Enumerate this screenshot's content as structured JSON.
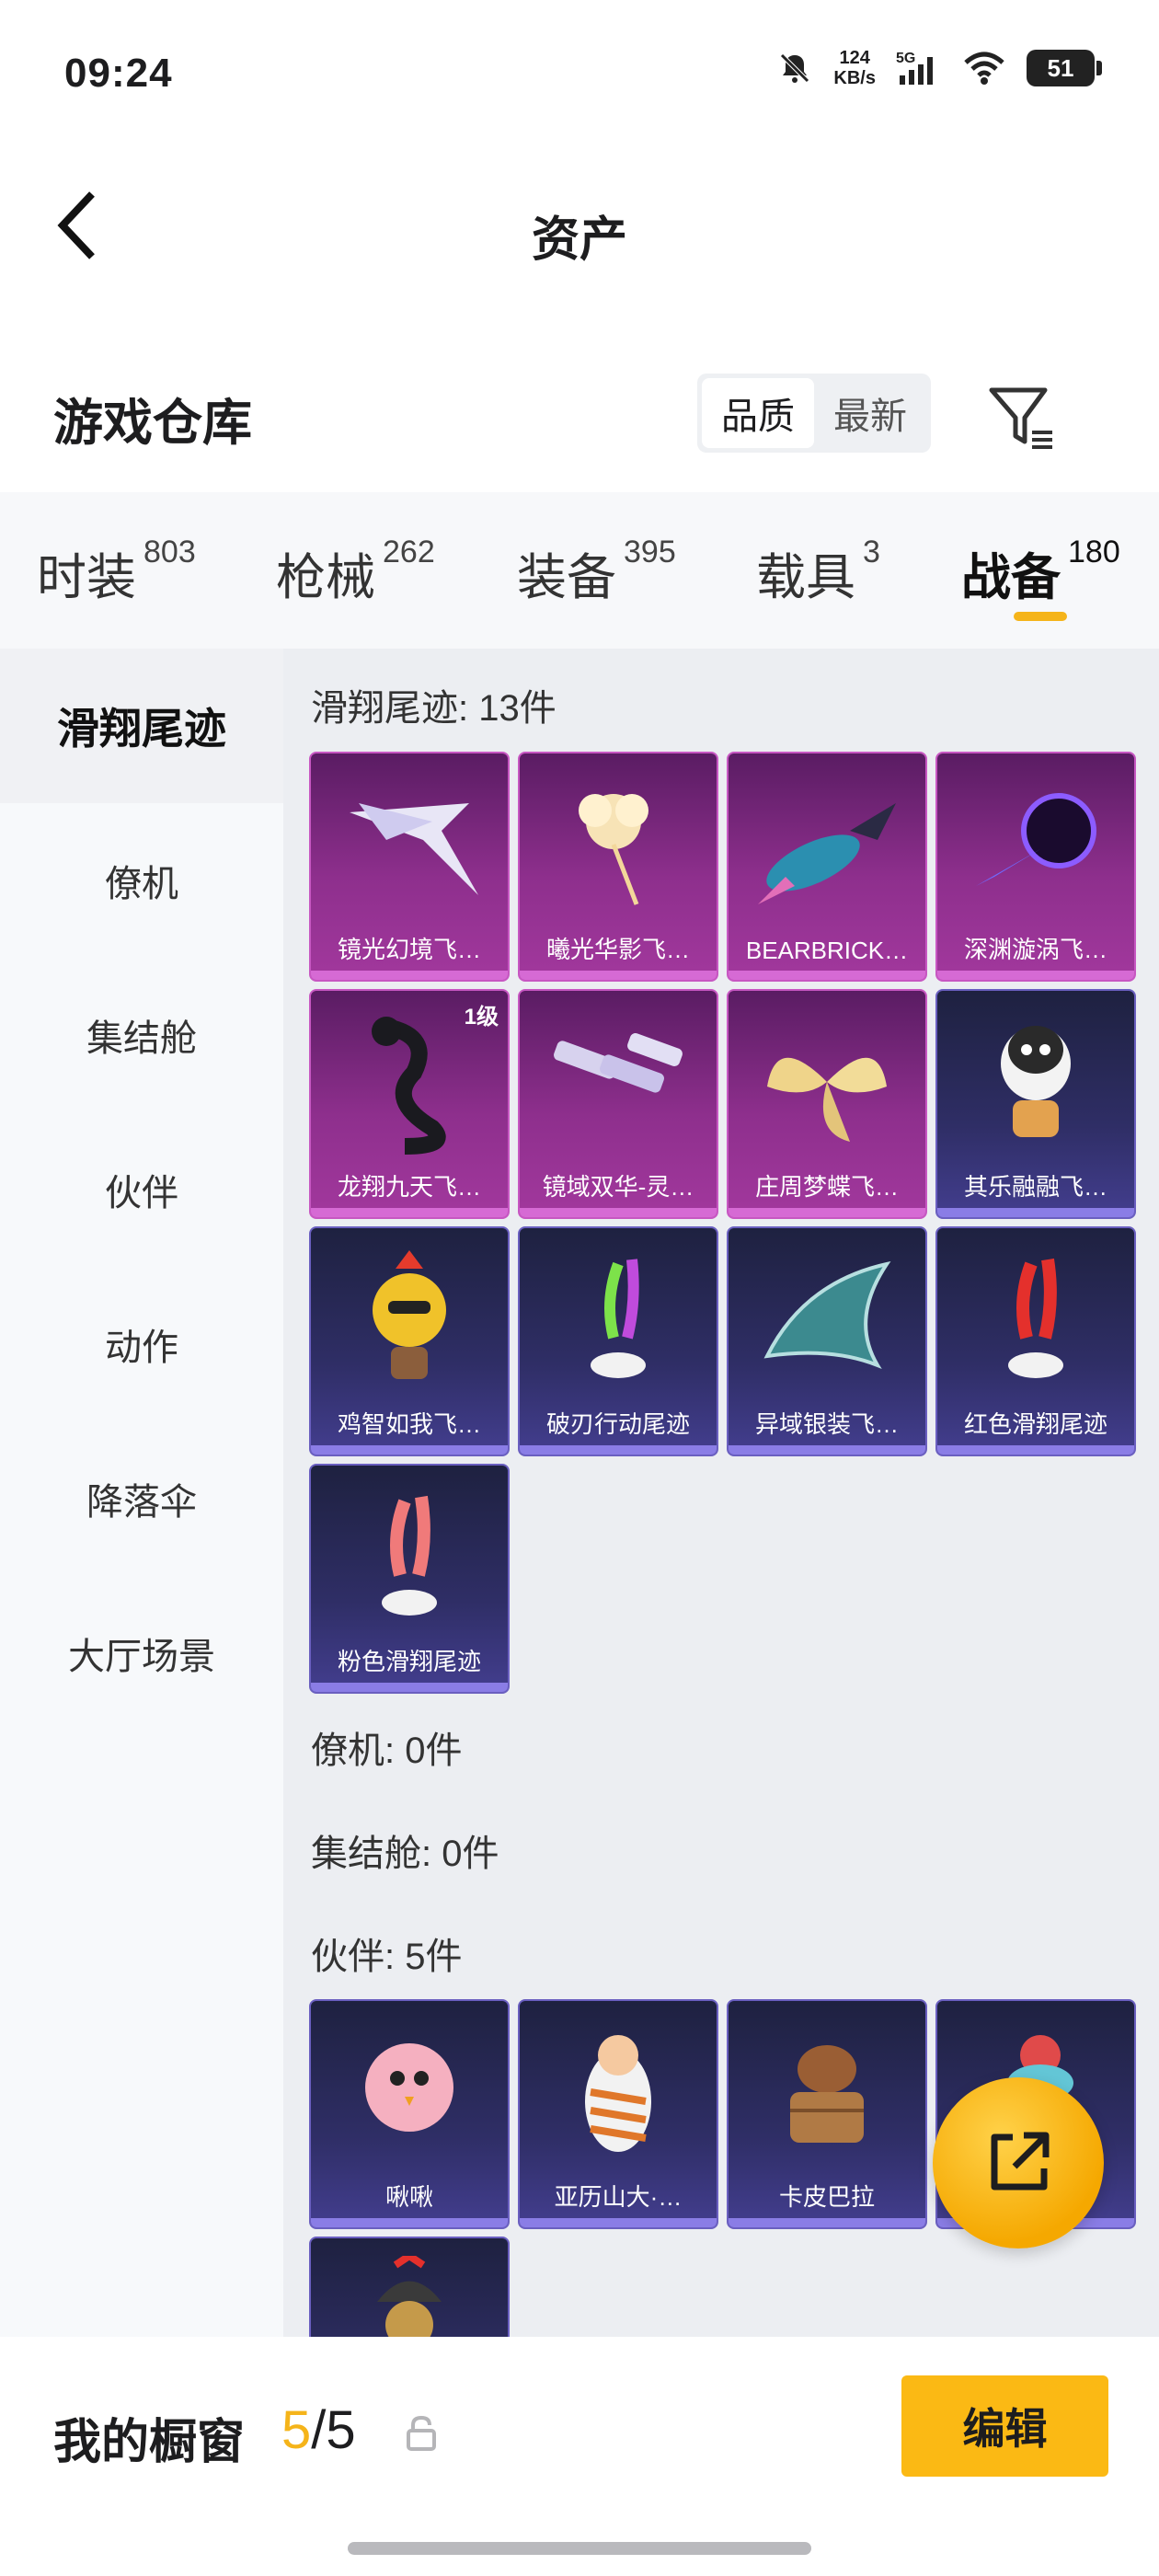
{
  "status_bar": {
    "time": "09:24",
    "net_speed_value": "124",
    "net_speed_unit": "KB/s",
    "network": "5G",
    "battery": "51"
  },
  "header": {
    "title": "资产"
  },
  "warehouse": {
    "title": "游戏仓库",
    "sort_options": [
      "品质",
      "最新"
    ],
    "sort_active": "品质"
  },
  "category_tabs": [
    {
      "label": "时装",
      "count": "803"
    },
    {
      "label": "枪械",
      "count": "262"
    },
    {
      "label": "装备",
      "count": "395"
    },
    {
      "label": "载具",
      "count": "3"
    },
    {
      "label": "战备",
      "count": "180",
      "active": true
    }
  ],
  "sidebar": {
    "items": [
      "滑翔尾迹",
      "僚机",
      "集结舱",
      "伙伴",
      "动作",
      "降落伞",
      "大厅场景"
    ],
    "active": "滑翔尾迹"
  },
  "sections": [
    {
      "label": "滑翔尾迹: 13件",
      "items": [
        {
          "name": "镜光幻境飞…",
          "rarity": "purple"
        },
        {
          "name": "曦光华影飞…",
          "rarity": "purple"
        },
        {
          "name": "BEARBRICK…",
          "rarity": "purple"
        },
        {
          "name": "深渊漩涡飞…",
          "rarity": "purple"
        },
        {
          "name": "龙翔九天飞…",
          "rarity": "purple",
          "level": "1级"
        },
        {
          "name": "镜域双华-灵…",
          "rarity": "purple"
        },
        {
          "name": "庄周梦蝶飞…",
          "rarity": "purple"
        },
        {
          "name": "其乐融融飞…",
          "rarity": "blue"
        },
        {
          "name": "鸡智如我飞…",
          "rarity": "blue"
        },
        {
          "name": "破刃行动尾迹",
          "rarity": "blue"
        },
        {
          "name": "异域银装飞…",
          "rarity": "blue"
        },
        {
          "name": "红色滑翔尾迹",
          "rarity": "blue"
        },
        {
          "name": "粉色滑翔尾迹",
          "rarity": "blue"
        }
      ]
    },
    {
      "label": "僚机: 0件",
      "items": []
    },
    {
      "label": "集结舱: 0件",
      "items": []
    },
    {
      "label": "伙伴: 5件",
      "items": [
        {
          "name": "啾啾",
          "rarity": "blue"
        },
        {
          "name": "亚历山大·…",
          "rarity": "blue"
        },
        {
          "name": "卡皮巴拉",
          "rarity": "blue"
        },
        {
          "name": "",
          "rarity": "blue"
        },
        {
          "name": "",
          "rarity": "blue"
        }
      ]
    }
  ],
  "footer": {
    "showcase_label": "我的橱窗",
    "showcase_current": "5",
    "showcase_sep_total": "/5",
    "edit_label": "编辑"
  },
  "colors": {
    "accent": "#f5b41a",
    "edit_button": "#fbb914",
    "rarity_purple": "#a2389d",
    "rarity_blue": "#433e8f"
  }
}
